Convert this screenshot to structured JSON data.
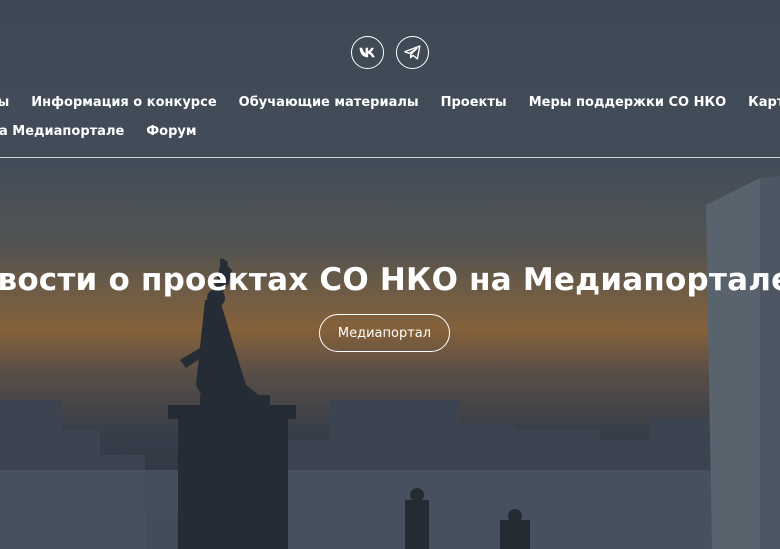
{
  "social": {
    "vk_label": "VK",
    "telegram_label": "Telegram"
  },
  "nav": {
    "row1": [
      "ты",
      "Информация о конкурсе",
      "Обучающие материалы",
      "Проекты",
      "Меры поддержки СО НКО",
      "Карта социальных про"
    ],
    "row2": [
      "на Медиапортале",
      "Форум"
    ]
  },
  "hero": {
    "headline": "овости о проектах СО НКО на Медиапортале",
    "cta_label": "Медиапортал"
  },
  "colors": {
    "text": "#ffffff",
    "overlay": "#3a4552",
    "sunset": "#a0703a"
  }
}
